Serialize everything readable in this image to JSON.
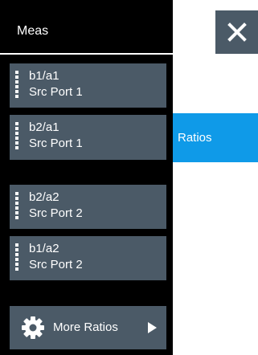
{
  "header": {
    "title": "Meas"
  },
  "close": {
    "icon": "close-icon"
  },
  "buttons": [
    {
      "line1": "b1/a1",
      "line2": "Src Port 1"
    },
    {
      "line1": "b2/a1",
      "line2": "Src Port 1"
    },
    {
      "line1": "b2/a2",
      "line2": "Src Port 2"
    },
    {
      "line1": "b1/a2",
      "line2": "Src Port 2"
    }
  ],
  "more": {
    "label": "More Ratios",
    "icon": "gear-icon",
    "arrow": "chevron-right-icon"
  },
  "submenu": {
    "label": "Ratios"
  },
  "colors": {
    "button_bg": "#4b5a67",
    "accent": "#0f9ae8",
    "panel_bg": "#000000"
  }
}
